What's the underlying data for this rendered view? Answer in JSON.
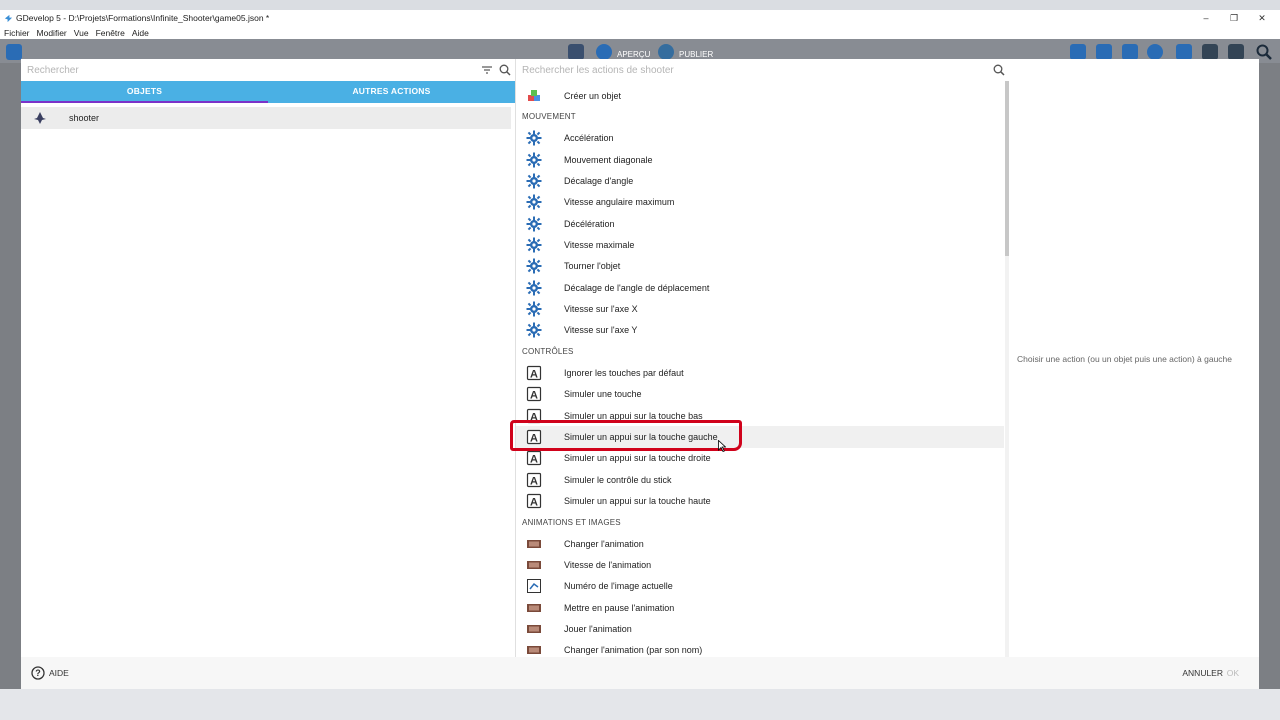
{
  "window": {
    "title": "GDevelop 5 - D:\\Projets\\Formations\\Infinite_Shooter\\game05.json *",
    "controls": [
      "–",
      "❐",
      "✕"
    ]
  },
  "menubar": [
    "Fichier",
    "Modifier",
    "Vue",
    "Fenêtre",
    "Aide"
  ],
  "toolbar": {
    "preview_label": "APERÇU",
    "publish_label": "PUBLIER"
  },
  "left": {
    "search_placeholder": "Rechercher",
    "tabs": [
      "OBJETS",
      "AUTRES ACTIONS"
    ],
    "objects": [
      {
        "name": "shooter"
      }
    ]
  },
  "right": {
    "search_placeholder": "Rechercher les actions de shooter",
    "sections": [
      {
        "type": "item",
        "icon": "create-object-icon",
        "label": "Créer un objet"
      },
      {
        "type": "header",
        "label": "MOUVEMENT"
      },
      {
        "type": "item",
        "icon": "movement-gear-icon",
        "label": "Accélération"
      },
      {
        "type": "item",
        "icon": "movement-gear-icon",
        "label": "Mouvement diagonale"
      },
      {
        "type": "item",
        "icon": "movement-gear-icon",
        "label": "Décalage d'angle"
      },
      {
        "type": "item",
        "icon": "movement-gear-icon",
        "label": "Vitesse angulaire maximum"
      },
      {
        "type": "item",
        "icon": "movement-gear-icon",
        "label": "Décélération"
      },
      {
        "type": "item",
        "icon": "movement-gear-icon",
        "label": "Vitesse maximale"
      },
      {
        "type": "item",
        "icon": "movement-gear-icon",
        "label": "Tourner l'objet"
      },
      {
        "type": "item",
        "icon": "movement-gear-icon",
        "label": "Décalage de l'angle de déplacement"
      },
      {
        "type": "item",
        "icon": "movement-gear-icon",
        "label": "Vitesse sur l'axe X"
      },
      {
        "type": "item",
        "icon": "movement-gear-icon",
        "label": "Vitesse sur l'axe Y"
      },
      {
        "type": "header",
        "label": "CONTRÔLES"
      },
      {
        "type": "item",
        "icon": "keyboard-key-icon",
        "label": "Ignorer les touches par défaut"
      },
      {
        "type": "item",
        "icon": "keyboard-key-icon",
        "label": "Simuler une touche"
      },
      {
        "type": "item",
        "icon": "keyboard-key-icon",
        "label": "Simuler un appui sur la touche bas"
      },
      {
        "type": "item",
        "icon": "keyboard-key-icon",
        "label": "Simuler un appui sur la touche gauche",
        "hover": true
      },
      {
        "type": "item",
        "icon": "keyboard-key-icon",
        "label": "Simuler un appui sur la touche droite"
      },
      {
        "type": "item",
        "icon": "keyboard-key-icon",
        "label": "Simuler le contrôle du stick"
      },
      {
        "type": "item",
        "icon": "keyboard-key-icon",
        "label": "Simuler un appui sur la touche haute"
      },
      {
        "type": "header",
        "label": "ANIMATIONS ET IMAGES"
      },
      {
        "type": "item",
        "icon": "animation-film-icon",
        "label": "Changer l'animation"
      },
      {
        "type": "item",
        "icon": "animation-film-icon",
        "label": "Vitesse de l'animation"
      },
      {
        "type": "item",
        "icon": "image-number-icon",
        "label": "Numéro de l'image actuelle"
      },
      {
        "type": "item",
        "icon": "animation-film-icon",
        "label": "Mettre en pause l'animation"
      },
      {
        "type": "item",
        "icon": "animation-film-icon",
        "label": "Jouer l'animation"
      },
      {
        "type": "item",
        "icon": "animation-film-icon",
        "label": "Changer l'animation (par son nom)"
      }
    ]
  },
  "detail": {
    "hint": "Choisir une action (ou un objet puis une action) à gauche"
  },
  "footer": {
    "help_label": "AIDE",
    "cancel_label": "ANNULER",
    "ok_label": "OK"
  },
  "colors": {
    "accent": "#4ab0e4",
    "tab_indicator": "#7b32c9",
    "annotation": "#d0021b"
  }
}
